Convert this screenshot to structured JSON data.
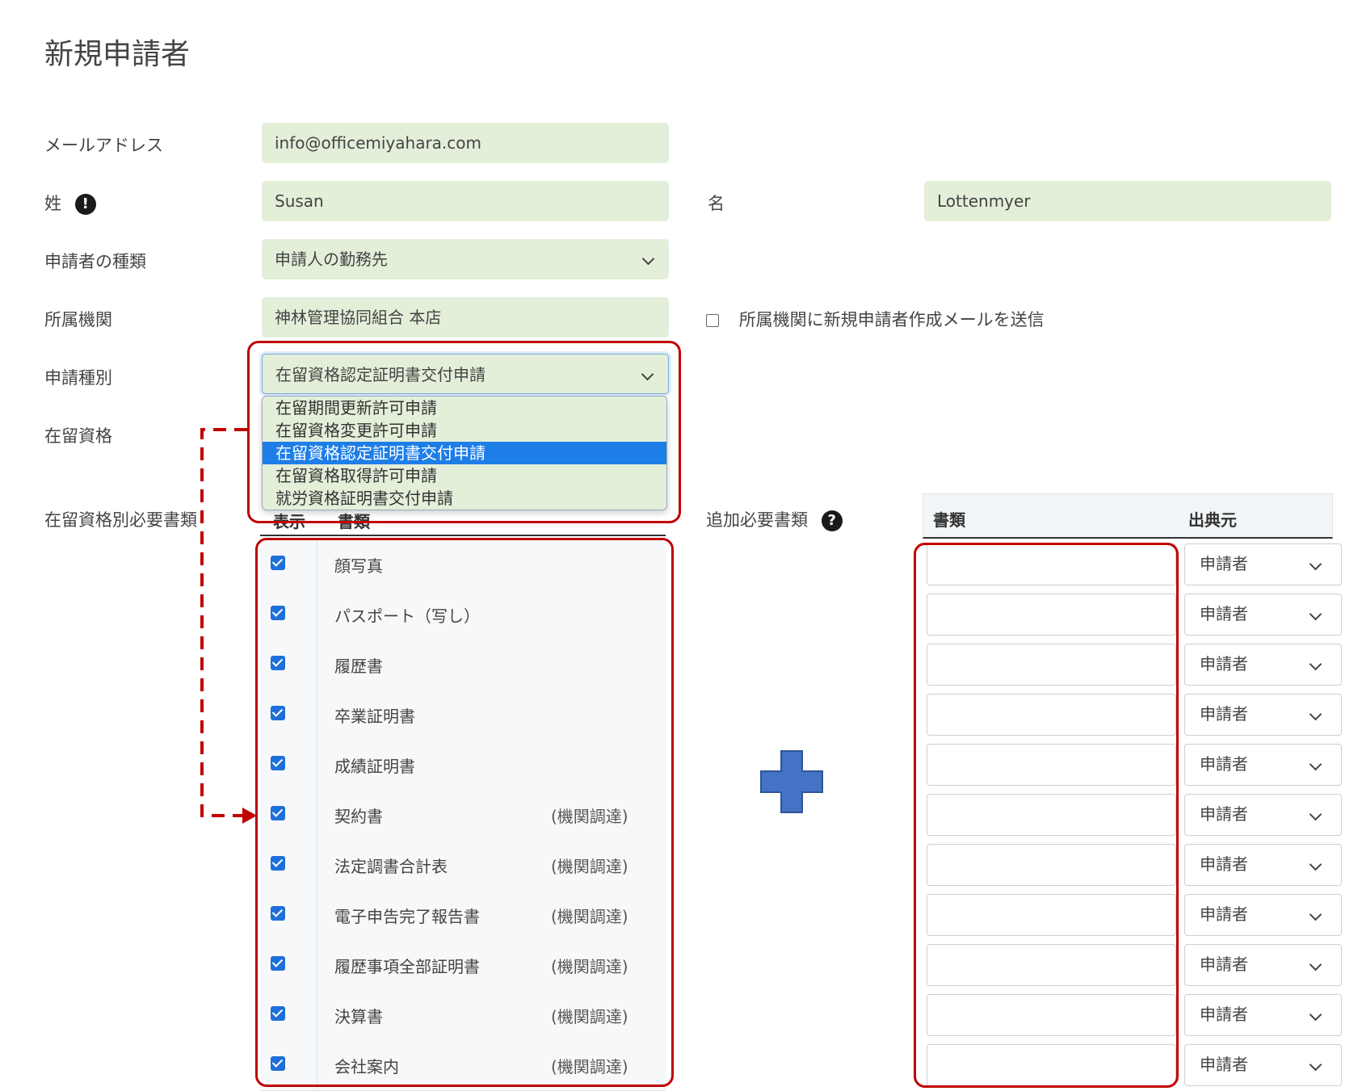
{
  "page_title": "新規申請者",
  "form": {
    "email": {
      "label": "メールアドレス",
      "value": "info@officemiyahara.com"
    },
    "last_name": {
      "label": "姓",
      "value": "Susan",
      "alert_glyph": "!"
    },
    "first_name": {
      "label": "名",
      "value": "Lottenmyer"
    },
    "applicant_type": {
      "label": "申請者の種類",
      "value": "申請人の勤務先"
    },
    "affiliation": {
      "label": "所属機関",
      "value": "神林管理協同組合 本店"
    },
    "send_mail": {
      "label": "所属機関に新規申請者作成メールを送信",
      "checked": false
    },
    "application_type": {
      "label": "申請種別",
      "value": "在留資格認定証明書交付申請",
      "options": [
        "在留期間更新許可申請",
        "在留資格変更許可申請",
        "在留資格認定証明書交付申請",
        "在留資格取得許可申請",
        "就労資格証明書交付申請"
      ],
      "selected_index": 2
    },
    "status_of_residence": {
      "label": "在留資格"
    }
  },
  "required_docs": {
    "label": "在留資格別必要書類",
    "columns": [
      "表示",
      "書類"
    ],
    "rows": [
      {
        "name": "顔写真",
        "note": "",
        "checked": true
      },
      {
        "name": "パスポート（写し）",
        "note": "",
        "checked": true
      },
      {
        "name": "履歴書",
        "note": "",
        "checked": true
      },
      {
        "name": "卒業証明書",
        "note": "",
        "checked": true
      },
      {
        "name": "成績証明書",
        "note": "",
        "checked": true
      },
      {
        "name": "契約書",
        "note": "(機関調達)",
        "checked": true
      },
      {
        "name": "法定調書合計表",
        "note": "(機関調達)",
        "checked": true
      },
      {
        "name": "電子申告完了報告書",
        "note": "(機関調達)",
        "checked": true
      },
      {
        "name": "履歴事項全部証明書",
        "note": "(機関調達)",
        "checked": true
      },
      {
        "name": "決算書",
        "note": "(機関調達)",
        "checked": true
      },
      {
        "name": "会社案内",
        "note": "(機関調達)",
        "checked": true
      }
    ]
  },
  "additional_docs": {
    "label": "追加必要書類",
    "help_glyph": "?",
    "columns": [
      "書類",
      "出典元"
    ],
    "rows": [
      {
        "doc": "",
        "source": "申請者"
      },
      {
        "doc": "",
        "source": "申請者"
      },
      {
        "doc": "",
        "source": "申請者"
      },
      {
        "doc": "",
        "source": "申請者"
      },
      {
        "doc": "",
        "source": "申請者"
      },
      {
        "doc": "",
        "source": "申請者"
      },
      {
        "doc": "",
        "source": "申請者"
      },
      {
        "doc": "",
        "source": "申請者"
      },
      {
        "doc": "",
        "source": "申請者"
      },
      {
        "doc": "",
        "source": "申請者"
      },
      {
        "doc": "",
        "source": "申請者"
      }
    ]
  },
  "annotations": {
    "highlight_color": "#c00000",
    "plus_color": "#4472c4",
    "connector_icon": "dashed-arrow-icon",
    "plus_icon": "plus-icon"
  }
}
